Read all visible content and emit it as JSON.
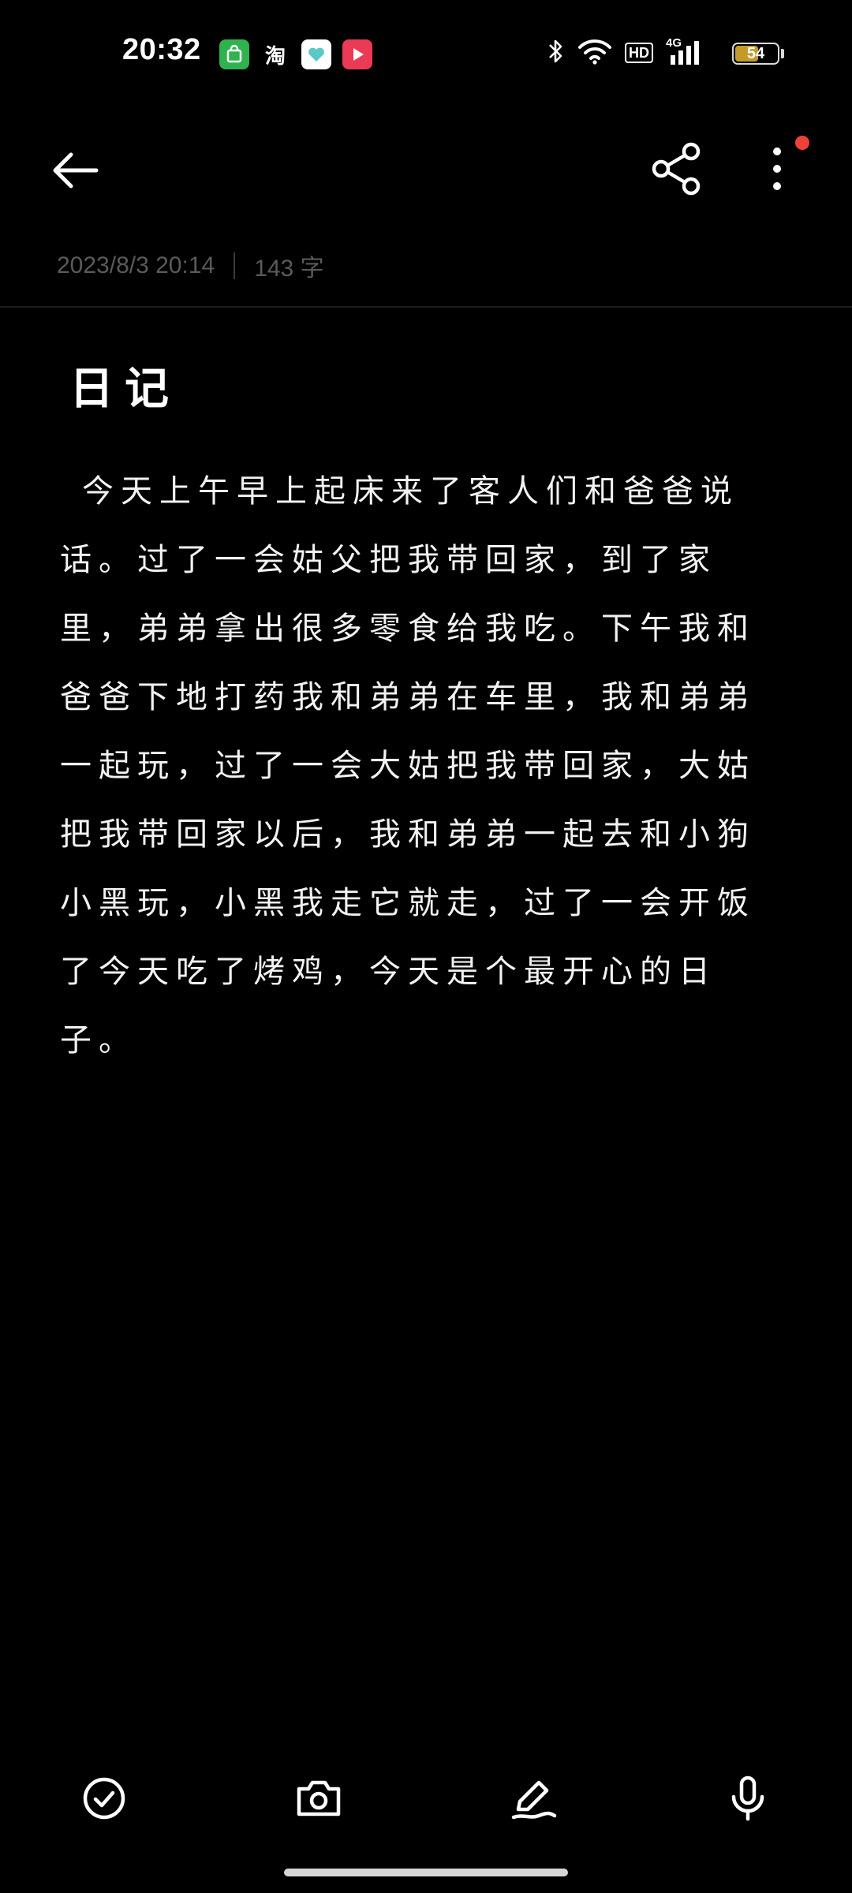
{
  "status_bar": {
    "time": "20:32",
    "app_icons": [
      "shop-icon",
      "taobao-icon",
      "heart-app-icon",
      "video-icon"
    ],
    "taobao_label": "淘",
    "network_badge": "HD",
    "network_type": "4G",
    "battery_level": "54"
  },
  "toolbar_top": {
    "back_icon": "arrow-left-icon",
    "share_icon": "share-icon",
    "more_icon": "more-vertical-icon",
    "has_notification": true
  },
  "note": {
    "date": "2023/8/3 20:14",
    "word_count": "143 字",
    "title": "日记",
    "body": "今天上午早上起床来了客人们和爸爸说话。过了一会姑父把我带回家，到了家里，弟弟拿出很多零食给我吃。下午我和爸爸下地打药我和弟弟在车里，我和弟弟一起玩，过了一会大姑把我带回家，大姑把我带回家以后，我和弟弟一起去和小狗小黑玩，小黑我走它就走，过了一会开饭了今天吃了烤鸡，今天是个最开心的日子。"
  },
  "bottom_toolbar": {
    "items": [
      "checklist-icon",
      "camera-icon",
      "pen-icon",
      "microphone-icon"
    ]
  },
  "colors": {
    "background": "#000000",
    "text": "#ffffff",
    "meta_text": "#5a5a5a",
    "notification": "#f0403a"
  }
}
